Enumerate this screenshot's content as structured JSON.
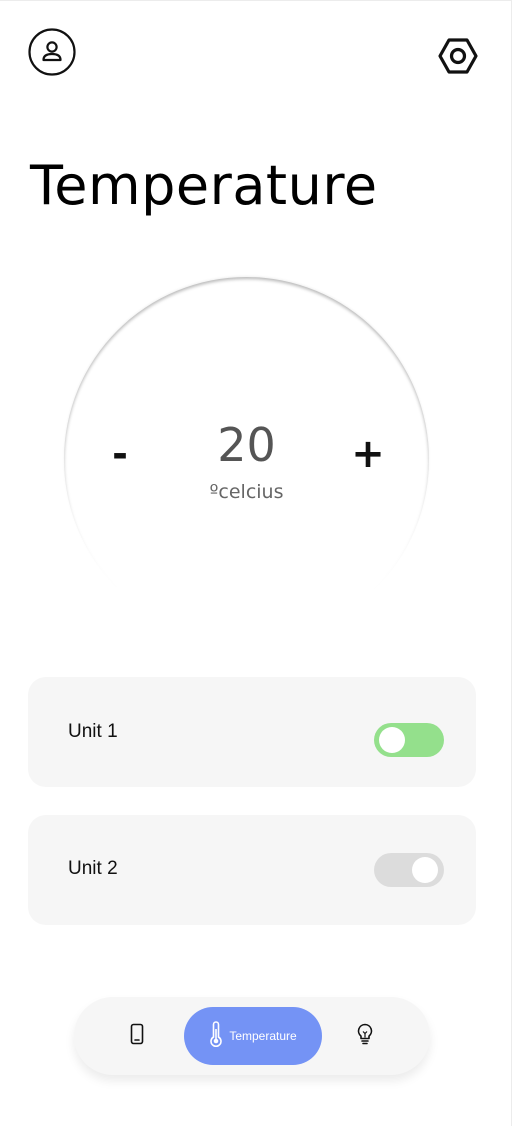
{
  "header": {
    "profile_icon": "user-icon",
    "settings_icon": "hexagon-gear-icon"
  },
  "page": {
    "title": "Temperature"
  },
  "dial": {
    "decrease_label": "-",
    "increase_label": "+",
    "value": "20",
    "unit": "ºcelcius"
  },
  "units": [
    {
      "label": "Unit 1",
      "on": true,
      "on_color": "#94e08c"
    },
    {
      "label": "Unit 2",
      "on": false,
      "off_color": "#dcdcdc"
    }
  ],
  "bottom_nav": {
    "items": [
      {
        "icon": "phone-icon",
        "active": false
      },
      {
        "icon": "thermometer-icon",
        "label": "Temperature",
        "active": true
      },
      {
        "icon": "lightbulb-icon",
        "active": false
      }
    ],
    "active_color": "#7493f5"
  }
}
